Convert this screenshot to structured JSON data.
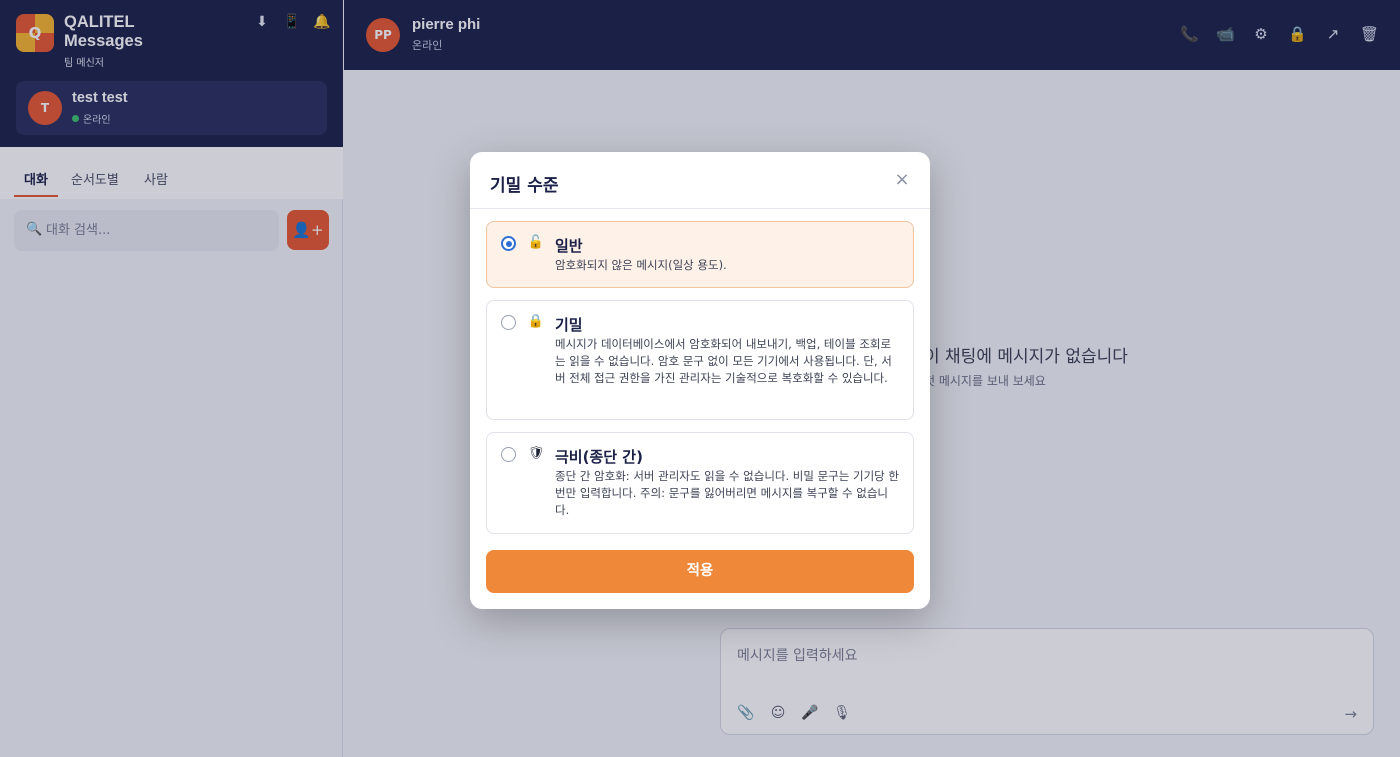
{
  "app": {
    "name": "QALITEL Messages",
    "logo_letter": "Q",
    "subtitle": "팀 메신저"
  },
  "header_icons": [
    "download-icon",
    "mobile-icon",
    "bell-icon"
  ],
  "current_user": {
    "initial": "T",
    "name": "test test",
    "status": "온라인"
  },
  "sidebar": {
    "tabs": [
      {
        "label": "대화",
        "active": true
      },
      {
        "label": "순서도별",
        "active": false
      },
      {
        "label": "사람",
        "active": false
      }
    ],
    "search_placeholder": "대화 검색...",
    "add_button_label": "👤+"
  },
  "chat": {
    "peer_initials": "PP",
    "peer_name": "pierre phi",
    "peer_status": "온라인",
    "header_icons": [
      "phone-icon",
      "video-icon",
      "settings-icon",
      "lock-icon",
      "share-icon",
      "trash-icon"
    ],
    "empty_title": "이 채팅에 메시지가 없습니다",
    "empty_subtitle": "첫 메시지를 보내 보세요",
    "composer_placeholder": "메시지를 입력하세요",
    "composer_tools": [
      "attach-icon",
      "emoji-icon",
      "microphone-icon",
      "voice-icon"
    ],
    "send_label": "→"
  },
  "modal": {
    "title": "기밀 수준",
    "close_label": "×",
    "options": [
      {
        "title": "일반",
        "icon": "unlock-icon",
        "selected": true,
        "description": "암호화되지 않은 메시지(일상 용도)."
      },
      {
        "title": "기밀",
        "icon": "lock-icon",
        "selected": false,
        "description": "메시지가 데이터베이스에서 암호화되어 내보내기, 백업, 테이블 조회로는 읽을 수 없습니다. 암호 문구 없이 모든 기기에서 사용됩니다. 단, 서버 전체 접근 권한을 가진 관리자는 기술적으로 복호화할 수 있습니다."
      },
      {
        "title": "극비(종단 간)",
        "icon": "shield-icon",
        "selected": false,
        "description": "종단 간 암호화: 서버 관리자도 읽을 수 없습니다. 비밀 문구는 기기당 한 번만 입력합니다. 주의: 문구를 잃어버리면 메시지를 복구할 수 없습니다."
      }
    ],
    "apply_label": "적용"
  },
  "colors": {
    "navy": "#1b2147",
    "accent_orange": "#e8572f",
    "apply_orange": "#f0883a",
    "selected_bg": "#fdf1e8",
    "online_green": "#3ec46d",
    "radio_blue": "#2e6fd6"
  }
}
